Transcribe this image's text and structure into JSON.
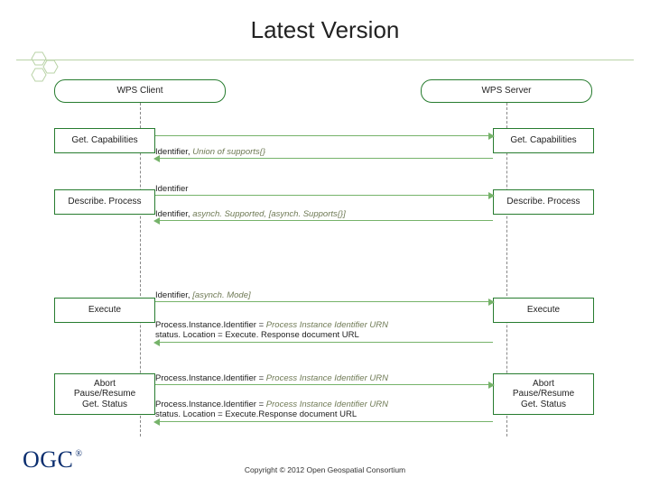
{
  "title": "Latest Version",
  "client_label": "WPS Client",
  "server_label": "WPS Server",
  "ops": {
    "getcap_c": "Get. Capabilities",
    "getcap_s": "Get. Capabilities",
    "desc_c": "Describe. Process",
    "desc_s": "Describe. Process",
    "exec_c": "Execute",
    "exec_s": "Execute",
    "ctrl_c": "Abort\nPause/Resume\nGet. Status",
    "ctrl_s": "Abort\nPause/Resume\nGet. Status"
  },
  "msgs": {
    "m1_pre": "Identifier, ",
    "m1_it": "Union of supports{}",
    "m2": "Identifier",
    "m3_pre": "Identifier, ",
    "m3_it": "asynch. Supported, [asynch. Supports{}]",
    "m4_pre": "Identifier, ",
    "m4_it": "[asynch. Mode]",
    "m5_pre": "Process.Instance.Identifier = ",
    "m5_it": "Process Instance Identifier URN",
    "m5_line2": "status. Location = Execute. Response document URL",
    "m6_pre": "Process.Instance.Identifier = ",
    "m6_it": "Process Instance Identifier URN",
    "m7_pre": "Process.Instance.Identifier = ",
    "m7_it": "Process Instance Identifier URN",
    "m7_line2": "status. Location = Execute.Response document URL"
  },
  "logo": "OGC",
  "reg": "®",
  "copyright": "Copyright © 2012 Open Geospatial Consortium"
}
